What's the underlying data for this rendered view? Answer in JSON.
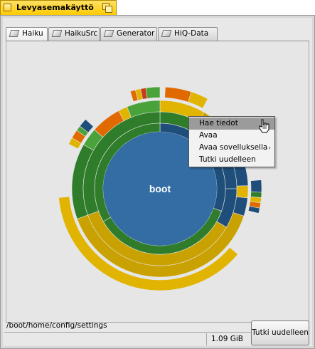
{
  "window": {
    "title": "Levyasemakäyttö"
  },
  "tabs": [
    {
      "label": "Haiku",
      "active": true
    },
    {
      "label": "HaikuSrc",
      "active": false
    },
    {
      "label": "Generator",
      "active": false
    },
    {
      "label": "HiQ-Data",
      "active": false
    }
  ],
  "chart": {
    "center_label": "boot",
    "colors": {
      "center": "#336da3",
      "blue_dark": "#1f4e7a",
      "green": "#2f7d2a",
      "green_light": "#4aa33a",
      "yellow": "#e0b400",
      "yellow_dark": "#c9a100",
      "orange": "#e06a00",
      "red": "#c73c1a",
      "background": "#e6e6e6"
    }
  },
  "context_menu": {
    "items": [
      {
        "label": "Hae tiedot",
        "highlighted": true,
        "submenu": false
      },
      {
        "label": "Avaa",
        "highlighted": false,
        "submenu": false
      },
      {
        "label": "Avaa sovelluksella",
        "highlighted": false,
        "submenu": true
      },
      {
        "label": "Tutki uudelleen",
        "highlighted": false,
        "submenu": false
      }
    ],
    "submenu_arrow": "›"
  },
  "status": {
    "path": "/boot/home/config/settings",
    "size": "1.09 GiB"
  },
  "rescan_button": {
    "label": "Tutki uudelleen"
  },
  "icons": {
    "cursor": "hand-pointer-icon",
    "tab": "volume-icon"
  }
}
